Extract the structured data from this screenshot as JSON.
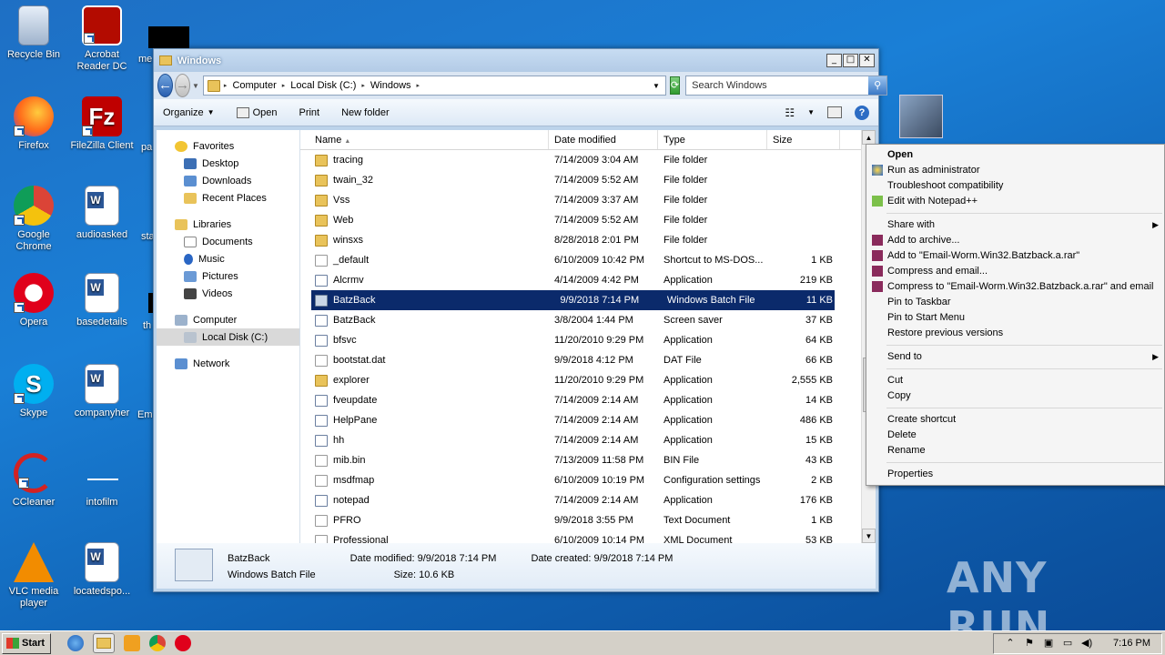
{
  "desktop": {
    "icons": [
      {
        "label": "Recycle Bin"
      },
      {
        "label": "Acrobat Reader DC"
      },
      {
        "label": "Firefox"
      },
      {
        "label": "FileZilla Client"
      },
      {
        "label": "Google Chrome"
      },
      {
        "label": "audioasked"
      },
      {
        "label": "Opera"
      },
      {
        "label": "basedetails"
      },
      {
        "label": "Skype"
      },
      {
        "label": "companyher"
      },
      {
        "label": "CCleaner"
      },
      {
        "label": "intofilm"
      },
      {
        "label": "VLC media player"
      },
      {
        "label": "locatedspo..."
      }
    ],
    "partial_labels": [
      "me",
      "pa",
      "sta",
      "th",
      "Em"
    ]
  },
  "window": {
    "title": "Windows",
    "address": {
      "crumbs": [
        "Computer",
        "Local Disk (C:)",
        "Windows"
      ]
    },
    "search_placeholder": "Search Windows",
    "toolbar": {
      "organize": "Organize",
      "open": "Open",
      "print": "Print",
      "new_folder": "New folder"
    },
    "nav": {
      "favorites": "Favorites",
      "desktop": "Desktop",
      "downloads": "Downloads",
      "recent": "Recent Places",
      "libraries": "Libraries",
      "documents": "Documents",
      "music": "Music",
      "pictures": "Pictures",
      "videos": "Videos",
      "computer": "Computer",
      "local_disk": "Local Disk (C:)",
      "network": "Network"
    },
    "columns": {
      "name": "Name",
      "date": "Date modified",
      "type": "Type",
      "size": "Size"
    },
    "files": [
      {
        "name": "tracing",
        "date": "7/14/2009 3:04 AM",
        "type": "File folder",
        "size": "",
        "icon": "folder"
      },
      {
        "name": "twain_32",
        "date": "7/14/2009 5:52 AM",
        "type": "File folder",
        "size": "",
        "icon": "folder"
      },
      {
        "name": "Vss",
        "date": "7/14/2009 3:37 AM",
        "type": "File folder",
        "size": "",
        "icon": "folder"
      },
      {
        "name": "Web",
        "date": "7/14/2009 5:52 AM",
        "type": "File folder",
        "size": "",
        "icon": "folder"
      },
      {
        "name": "winsxs",
        "date": "8/28/2018 2:01 PM",
        "type": "File folder",
        "size": "",
        "icon": "folder"
      },
      {
        "name": "_default",
        "date": "6/10/2009 10:42 PM",
        "type": "Shortcut to MS-DOS...",
        "size": "1 KB",
        "icon": "doc"
      },
      {
        "name": "Alcrmv",
        "date": "4/14/2009 4:42 PM",
        "type": "Application",
        "size": "219 KB",
        "icon": "app"
      },
      {
        "name": "BatzBack",
        "date": "9/9/2018 7:14 PM",
        "type": "Windows Batch File",
        "size": "11 KB",
        "icon": "bat",
        "selected": true
      },
      {
        "name": "BatzBack",
        "date": "3/8/2004 1:44 PM",
        "type": "Screen saver",
        "size": "37 KB",
        "icon": "app"
      },
      {
        "name": "bfsvc",
        "date": "11/20/2010 9:29 PM",
        "type": "Application",
        "size": "64 KB",
        "icon": "app"
      },
      {
        "name": "bootstat.dat",
        "date": "9/9/2018 4:12 PM",
        "type": "DAT File",
        "size": "66 KB",
        "icon": "doc"
      },
      {
        "name": "explorer",
        "date": "11/20/2010 9:29 PM",
        "type": "Application",
        "size": "2,555 KB",
        "icon": "folder"
      },
      {
        "name": "fveupdate",
        "date": "7/14/2009 2:14 AM",
        "type": "Application",
        "size": "14 KB",
        "icon": "app"
      },
      {
        "name": "HelpPane",
        "date": "7/14/2009 2:14 AM",
        "type": "Application",
        "size": "486 KB",
        "icon": "app"
      },
      {
        "name": "hh",
        "date": "7/14/2009 2:14 AM",
        "type": "Application",
        "size": "15 KB",
        "icon": "app"
      },
      {
        "name": "mib.bin",
        "date": "7/13/2009 11:58 PM",
        "type": "BIN File",
        "size": "43 KB",
        "icon": "doc"
      },
      {
        "name": "msdfmap",
        "date": "6/10/2009 10:19 PM",
        "type": "Configuration settings",
        "size": "2 KB",
        "icon": "doc"
      },
      {
        "name": "notepad",
        "date": "7/14/2009 2:14 AM",
        "type": "Application",
        "size": "176 KB",
        "icon": "app"
      },
      {
        "name": "PFRO",
        "date": "9/9/2018 3:55 PM",
        "type": "Text Document",
        "size": "1 KB",
        "icon": "doc"
      },
      {
        "name": "Professional",
        "date": "6/10/2009 10:14 PM",
        "type": "XML Document",
        "size": "53 KB",
        "icon": "doc"
      }
    ],
    "details": {
      "name": "BatzBack",
      "type": "Windows Batch File",
      "modified_label": "Date modified:",
      "modified": "9/9/2018 7:14 PM",
      "size_label": "Size:",
      "size": "10.6 KB",
      "created_label": "Date created:",
      "created": "9/9/2018 7:14 PM"
    }
  },
  "context_menu": {
    "items": [
      {
        "label": "Open",
        "bold": true
      },
      {
        "label": "Run as administrator",
        "icon": "shield"
      },
      {
        "label": "Troubleshoot compatibility"
      },
      {
        "label": "Edit with Notepad++",
        "icon": "notepadpp"
      },
      {
        "sep": true
      },
      {
        "label": "Share with",
        "submenu": true
      },
      {
        "label": "Add to archive...",
        "icon": "winrar"
      },
      {
        "label": "Add to \"Email-Worm.Win32.Batzback.a.rar\"",
        "icon": "winrar"
      },
      {
        "label": "Compress and email...",
        "icon": "winrar"
      },
      {
        "label": "Compress to \"Email-Worm.Win32.Batzback.a.rar\" and email",
        "icon": "winrar"
      },
      {
        "label": "Pin to Taskbar"
      },
      {
        "label": "Pin to Start Menu"
      },
      {
        "label": "Restore previous versions"
      },
      {
        "sep": true
      },
      {
        "label": "Send to",
        "submenu": true
      },
      {
        "sep": true
      },
      {
        "label": "Cut"
      },
      {
        "label": "Copy"
      },
      {
        "sep": true
      },
      {
        "label": "Create shortcut"
      },
      {
        "label": "Delete"
      },
      {
        "label": "Rename"
      },
      {
        "sep": true
      },
      {
        "label": "Properties"
      }
    ]
  },
  "taskbar": {
    "start": "Start",
    "clock": "7:16 PM"
  },
  "watermark": "ANY RUN",
  "colors": {
    "selection": "#0b2a6b",
    "desktop": "#1a7fd6"
  }
}
